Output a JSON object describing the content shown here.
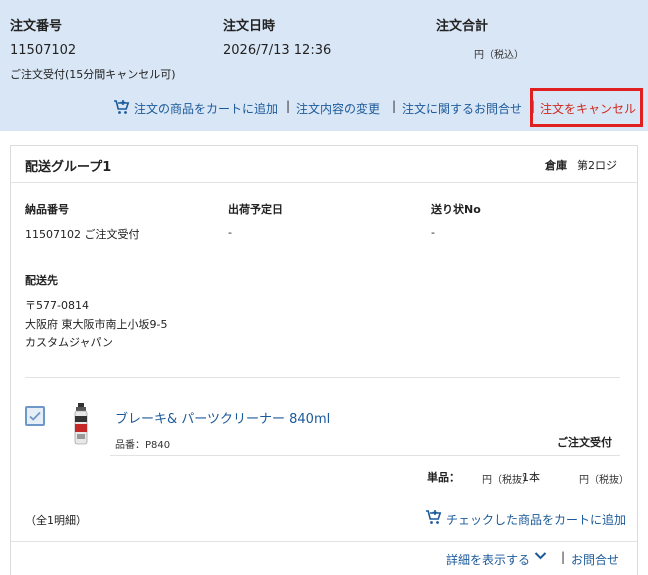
{
  "header": {
    "order_number_label": "注文番号",
    "order_number": "11507102",
    "order_status": "ご注文受付(15分間キャンセル可)",
    "order_date_label": "注文日時",
    "order_date": "2026/7/13 12:36",
    "order_total_label": "注文合計",
    "order_total_value": "円（税込）",
    "actions": {
      "add_to_cart": "注文の商品をカートに追加",
      "change_order": "注文内容の変更",
      "inquiry": "注文に関するお問合せ",
      "cancel": "注文をキャンセル",
      "separator": "|"
    }
  },
  "group": {
    "title": "配送グループ1",
    "warehouse_label": "倉庫",
    "warehouse": "第2ロジ",
    "delivery_no_label": "納品番号",
    "delivery_no": "11507102 ご注文受付",
    "ship_date_label": "出荷予定日",
    "ship_date": "-",
    "tracking_label": "送り状No",
    "tracking": "-",
    "destination_label": "配送先",
    "postal": "〒577-0814",
    "address": "大阪府 東大阪市南上小坂9-5",
    "recipient": "カスタムジャパン"
  },
  "item": {
    "name": "ブレーキ& パーツクリーナー 840ml",
    "code": "品番：P840",
    "status": "ご注文受付",
    "unit_price_label": "単品：",
    "unit_price": "円（税抜）",
    "quantity": "1本",
    "subtotal": "円（税抜）",
    "checked": true
  },
  "footer": {
    "count": "（全1明細）",
    "add_checked": "チェックした商品をカートに追加",
    "details": "詳細を表示する",
    "inquiry": "お問合せ",
    "separator": "|"
  },
  "colors": {
    "header_bg": "#d9e6f5",
    "link": "#1b5a9a",
    "cancel": "#d0281f",
    "highlight_border": "#e02020"
  },
  "icons": [
    "cart-plus-icon",
    "check-icon",
    "chevron-down-icon",
    "spray-can-icon"
  ]
}
